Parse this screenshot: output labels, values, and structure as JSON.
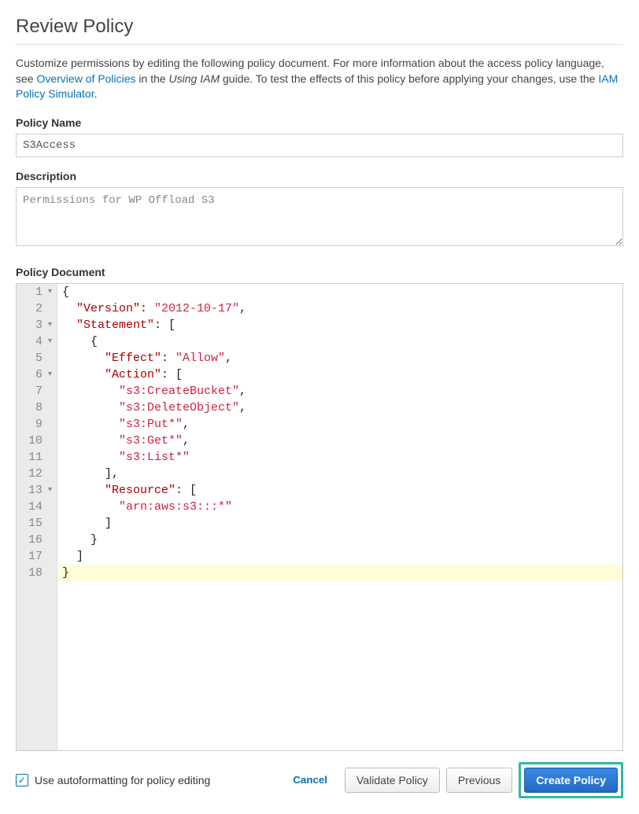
{
  "header": {
    "title": "Review Policy"
  },
  "intro": {
    "pre": "Customize permissions by editing the following policy document. For more information about the access policy language, see ",
    "link1": "Overview of Policies",
    "mid1": " in the ",
    "em": "Using IAM",
    "mid2": " guide. To test the effects of this policy before applying your changes, use the ",
    "link2": "IAM Policy Simulator",
    "post": "."
  },
  "fields": {
    "policy_name_label": "Policy Name",
    "policy_name_value": "S3Access",
    "description_label": "Description",
    "description_value": "Permissions for WP Offload S3",
    "policy_document_label": "Policy Document"
  },
  "editor": {
    "lines": [
      {
        "n": 1,
        "fold": true
      },
      {
        "n": 2,
        "fold": false
      },
      {
        "n": 3,
        "fold": true
      },
      {
        "n": 4,
        "fold": true
      },
      {
        "n": 5,
        "fold": false
      },
      {
        "n": 6,
        "fold": true
      },
      {
        "n": 7,
        "fold": false
      },
      {
        "n": 8,
        "fold": false
      },
      {
        "n": 9,
        "fold": false
      },
      {
        "n": 10,
        "fold": false
      },
      {
        "n": 11,
        "fold": false
      },
      {
        "n": 12,
        "fold": false
      },
      {
        "n": 13,
        "fold": true
      },
      {
        "n": 14,
        "fold": false
      },
      {
        "n": 15,
        "fold": false
      },
      {
        "n": 16,
        "fold": false
      },
      {
        "n": 17,
        "fold": false
      },
      {
        "n": 18,
        "fold": false
      }
    ],
    "tokens": {
      "brace_open": "{",
      "brace_close": "}",
      "bracket_open": "[",
      "bracket_close": "]",
      "version_key": "\"Version\"",
      "version_val": "\"2012-10-17\"",
      "statement_key": "\"Statement\"",
      "effect_key": "\"Effect\"",
      "effect_val": "\"Allow\"",
      "action_key": "\"Action\"",
      "a1": "\"s3:CreateBucket\"",
      "a2": "\"s3:DeleteObject\"",
      "a3": "\"s3:Put*\"",
      "a4": "\"s3:Get*\"",
      "a5": "\"s3:List*\"",
      "resource_key": "\"Resource\"",
      "r1": "\"arn:aws:s3:::*\""
    }
  },
  "footer": {
    "autoformat_label": "Use autoformatting for policy editing",
    "cancel": "Cancel",
    "validate": "Validate Policy",
    "previous": "Previous",
    "create": "Create Policy"
  }
}
